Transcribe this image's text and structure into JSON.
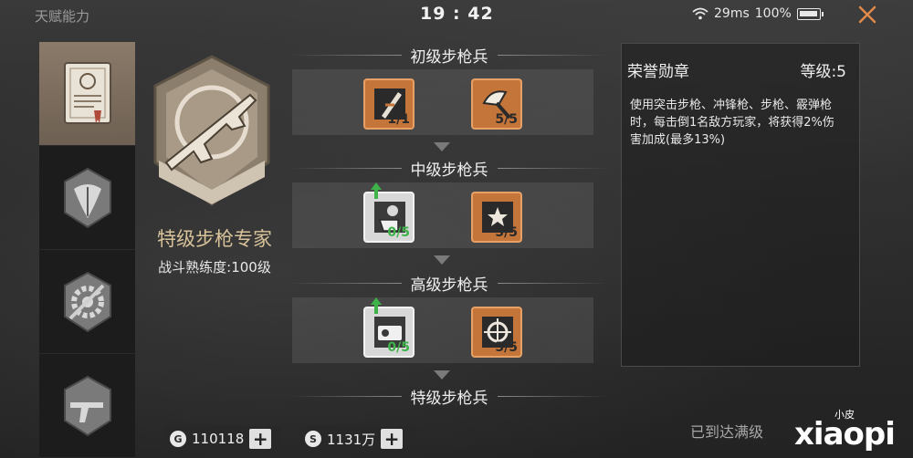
{
  "topbar": {
    "title": "天赋能力",
    "clock": "19 : 42",
    "ping": "29ms",
    "battery": "100%",
    "battery_level": 1.0
  },
  "tabs": [
    {
      "icon": "certificate-icon",
      "active": true
    },
    {
      "icon": "leaf-badge-icon",
      "active": false
    },
    {
      "icon": "gear-badge-icon",
      "active": false
    },
    {
      "icon": "smg-badge-icon",
      "active": false
    }
  ],
  "class_info": {
    "name": "特级步枪专家",
    "mastery": "战斗熟练度:100级"
  },
  "tiers": [
    {
      "title": "初级步枪兵",
      "skills": [
        {
          "icon": "rifle-scope-icon",
          "count": "1/1",
          "state": "maxed"
        },
        {
          "icon": "axe-icon",
          "count": "5/5",
          "state": "maxed"
        }
      ]
    },
    {
      "title": "中级步枪兵",
      "skills": [
        {
          "icon": "fist-grenade-icon",
          "count": "0/5",
          "state": "unlearned"
        },
        {
          "icon": "star-turret-icon",
          "count": "5/5",
          "state": "maxed"
        }
      ]
    },
    {
      "title": "高级步枪兵",
      "skills": [
        {
          "icon": "camera-icon",
          "count": "0/5",
          "state": "unlearned"
        },
        {
          "icon": "crosshair-icon",
          "count": "5/5",
          "state": "maxed"
        }
      ]
    },
    {
      "title": "特级步枪兵",
      "skills": []
    }
  ],
  "detail": {
    "name": "荣誉勋章",
    "level": "等级:5",
    "description": "使用突击步枪、冲锋枪、步枪、霰弹枪时，每击倒1名敌方玩家，将获得2%伤害加成(最多13%)"
  },
  "max_note": "已到达满级",
  "currency": [
    {
      "icon_label": "G",
      "value": "110118"
    },
    {
      "icon_label": "S",
      "value": "1131万"
    }
  ],
  "watermark": {
    "big": "xiaopi",
    "small": "小皮"
  },
  "colors": {
    "maxed": "#c4753a",
    "unlearned": "#d8d8d8",
    "count_green": "#3fb24a",
    "class_name": "#d8c29a"
  }
}
